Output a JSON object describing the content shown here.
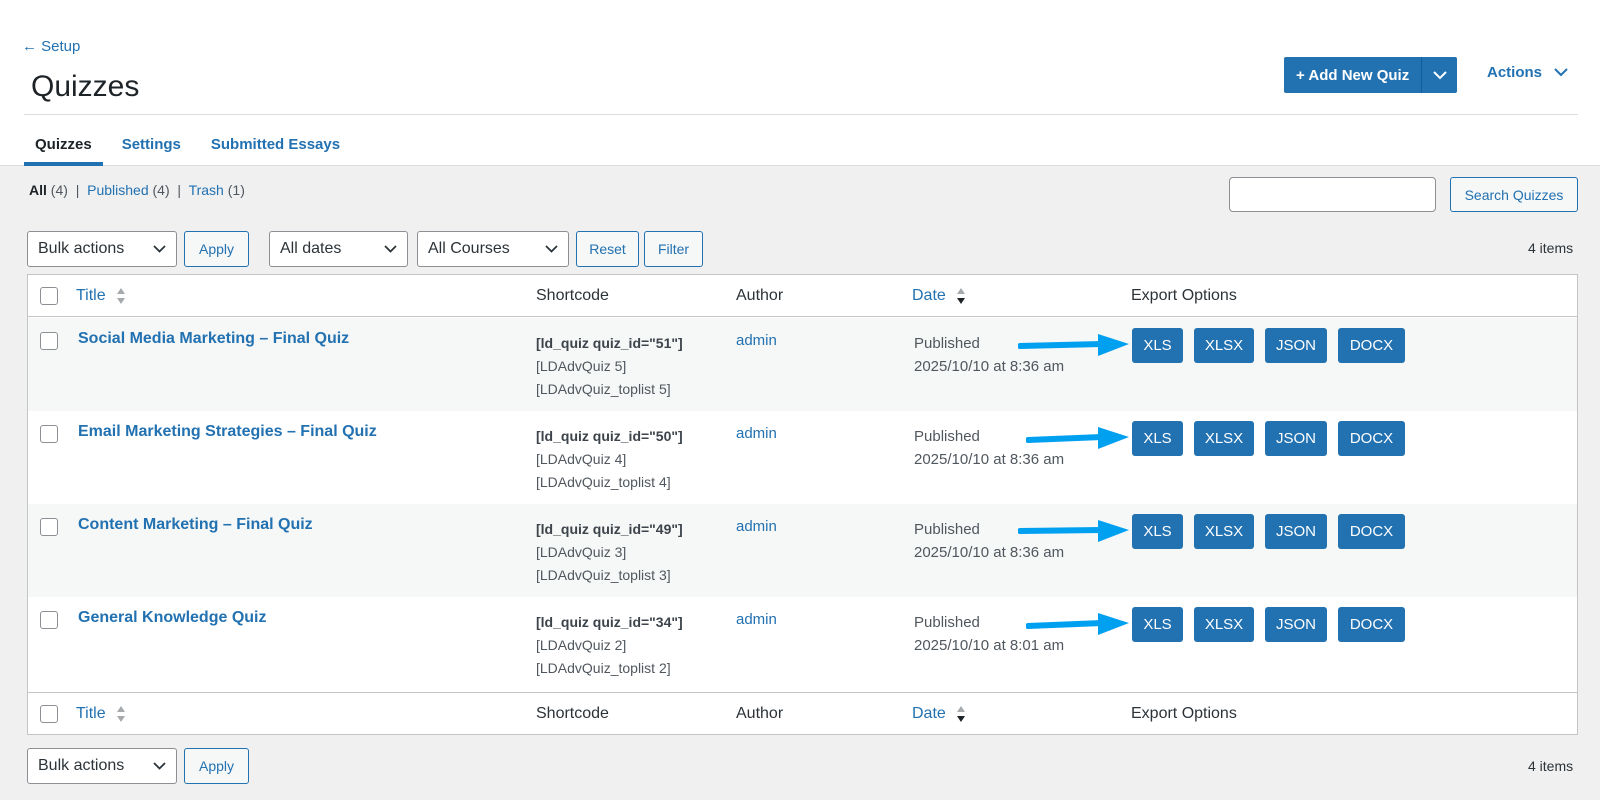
{
  "nav": {
    "back_label": "← Setup"
  },
  "page": {
    "title": "Quizzes"
  },
  "header_actions": {
    "add_new_label": "+ Add New Quiz",
    "actions_label": "Actions"
  },
  "tabs": [
    {
      "label": "Quizzes",
      "active": true
    },
    {
      "label": "Settings",
      "active": false
    },
    {
      "label": "Submitted Essays",
      "active": false
    }
  ],
  "views": {
    "all_label": "All",
    "all_count": "(4)",
    "published_label": "Published",
    "published_count": "(4)",
    "trash_label": "Trash",
    "trash_count": "(1)",
    "separator": "|"
  },
  "search": {
    "value": "",
    "button_label": "Search Quizzes"
  },
  "filters": {
    "bulk_actions": "Bulk actions",
    "apply": "Apply",
    "dates": "All dates",
    "courses": "All Courses",
    "reset": "Reset",
    "filter": "Filter"
  },
  "items_count": "4 items",
  "table": {
    "columns": {
      "title": "Title",
      "shortcode": "Shortcode",
      "author": "Author",
      "date": "Date",
      "export": "Export Options"
    },
    "export_buttons": [
      "XLS",
      "XLSX",
      "JSON",
      "DOCX"
    ],
    "rows": [
      {
        "title": "Social Media Marketing – Final Quiz",
        "shortcode_main": "[ld_quiz quiz_id=\"51\"]",
        "shortcode_adv": "[LDAdvQuiz 5]",
        "shortcode_toplist": "[LDAdvQuiz_toplist 5]",
        "author": "admin",
        "status": "Published",
        "date": "2025/10/10 at 8:36 am"
      },
      {
        "title": "Email Marketing Strategies – Final Quiz",
        "shortcode_main": "[ld_quiz quiz_id=\"50\"]",
        "shortcode_adv": "[LDAdvQuiz 4]",
        "shortcode_toplist": "[LDAdvQuiz_toplist 4]",
        "author": "admin",
        "status": "Published",
        "date": "2025/10/10 at 8:36 am"
      },
      {
        "title": "Content Marketing – Final Quiz",
        "shortcode_main": "[ld_quiz quiz_id=\"49\"]",
        "shortcode_adv": "[LDAdvQuiz 3]",
        "shortcode_toplist": "[LDAdvQuiz_toplist 3]",
        "author": "admin",
        "status": "Published",
        "date": "2025/10/10 at 8:36 am"
      },
      {
        "title": "General Knowledge Quiz",
        "shortcode_main": "[ld_quiz quiz_id=\"34\"]",
        "shortcode_adv": "[LDAdvQuiz 2]",
        "shortcode_toplist": "[LDAdvQuiz_toplist 2]",
        "author": "admin",
        "status": "Published",
        "date": "2025/10/10 at 8:01 am"
      }
    ]
  },
  "colors": {
    "primary": "#2271b1",
    "annotation_arrow": "#00a0f0",
    "background": "#f0f0f1"
  },
  "icons": {
    "sort": "sort-arrows-icon",
    "dropdown": "chevron-down-icon",
    "annotation": "arrow-right-icon"
  }
}
